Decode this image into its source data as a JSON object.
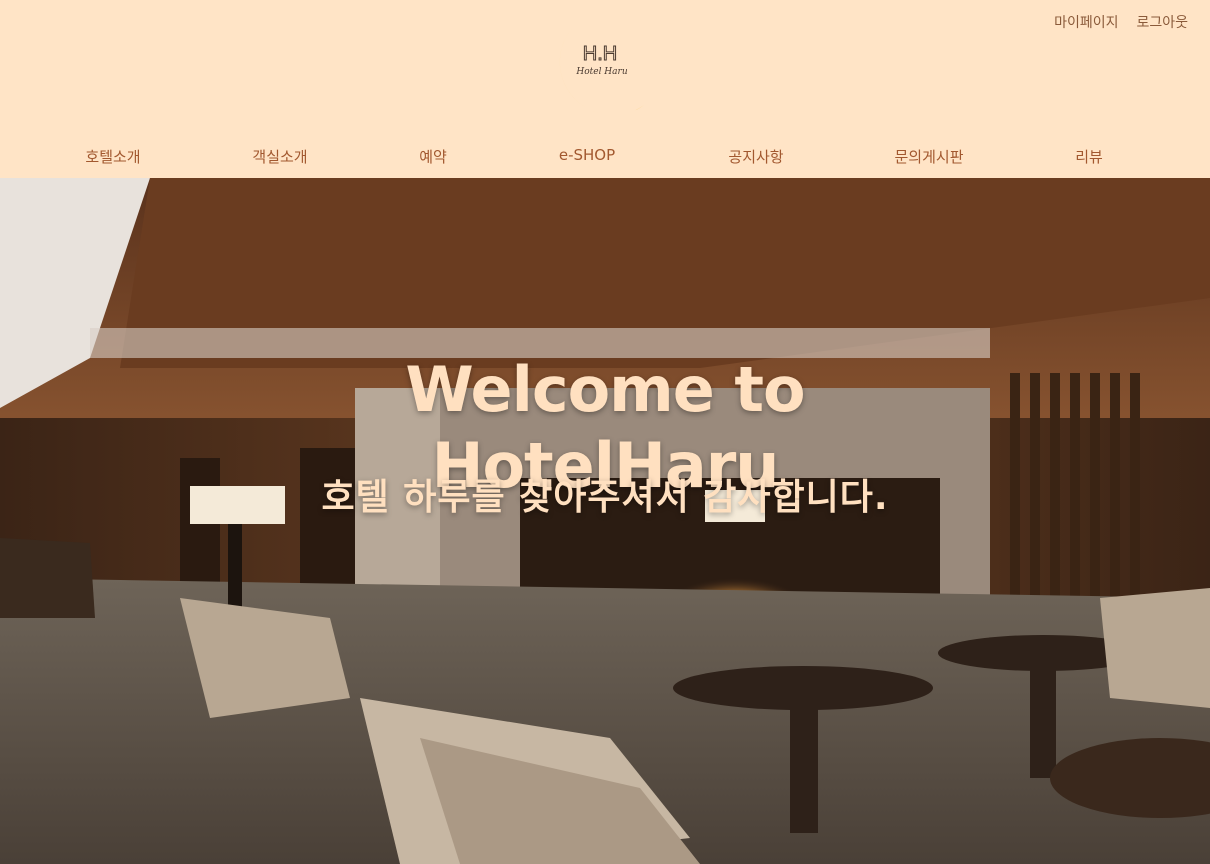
{
  "header": {
    "user_links": [
      {
        "label": "마이페이지"
      },
      {
        "label": "로그아웃"
      }
    ],
    "logo": {
      "monogram": "H.H",
      "name": "Hotel Haru",
      "colors": {
        "moon": "#f9c548",
        "text": "#4a3a30"
      }
    }
  },
  "nav": {
    "items": [
      {
        "label": "호텔소개"
      },
      {
        "label": "객실소개"
      },
      {
        "label": "예약"
      },
      {
        "label": "e-SHOP"
      },
      {
        "label": "공지사항"
      },
      {
        "label": "문의게시판"
      },
      {
        "label": "리뷰"
      }
    ]
  },
  "hero": {
    "title_line1": "Welcome to",
    "title_line2": "HotelHaru",
    "subtitle": "호텔 하루를 찾아주셔서 감사합니다.",
    "image_description": "hotel-lobby-photo"
  },
  "colors": {
    "background": "#ffe4c6",
    "nav_text": "#a2582f",
    "hero_text": "#ffe0c0"
  }
}
